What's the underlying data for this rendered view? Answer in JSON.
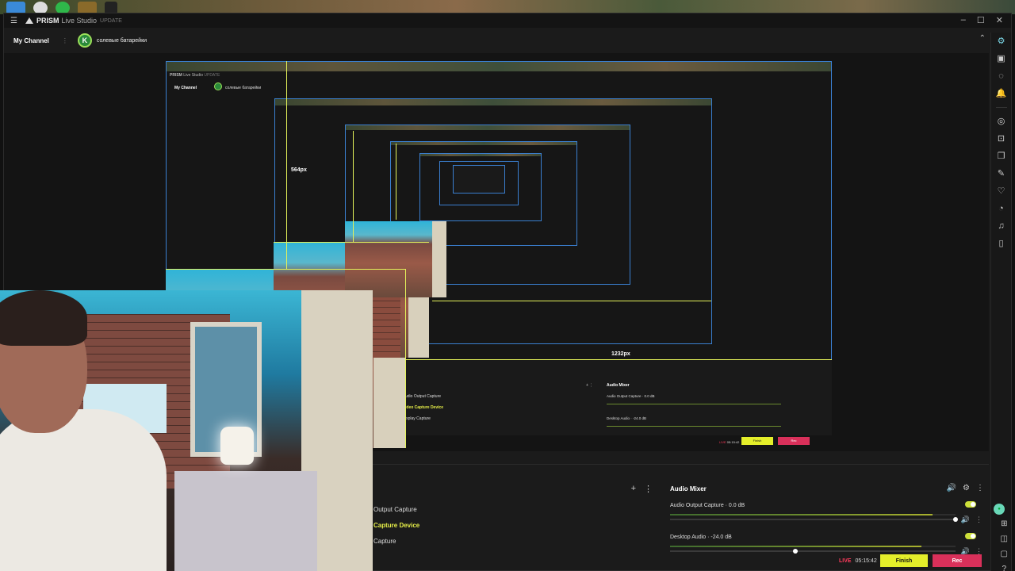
{
  "titlebar": {
    "app_name": "PRISM",
    "app_sub": "Live Studio",
    "update_label": "UPDATE"
  },
  "channelbar": {
    "my_channel": "My Channel",
    "channel_name": "солевые батарейки",
    "avatar_letter": "K"
  },
  "preview": {
    "nested_px_label_1": "564px",
    "nested_px_label_2": "1232px",
    "nested_frame_1": {
      "app_name": "PRISM",
      "app_sub": "Live Studio",
      "update_label": "UPDATE",
      "my_channel": "My Channel",
      "channel_name": "солевые батарейки",
      "mixer_title": "Audio Mixer",
      "channels": [
        "Audio Output Capture · 0.0 dB",
        "Desktop Audio · -24.0 dB"
      ],
      "sources": [
        "udio Output Capture",
        "ideo Capture Device",
        "isplay Capture"
      ],
      "live": "LIVE",
      "time": "05:15:42",
      "finish": "Finish",
      "rec": "Rec"
    }
  },
  "sources": {
    "items": [
      {
        "label": "Output Capture",
        "active": false
      },
      {
        "label": "Capture Device",
        "active": true
      },
      {
        "label": "Capture",
        "active": false
      }
    ]
  },
  "mixer": {
    "title": "Audio Mixer",
    "channels": [
      {
        "label": "Audio Output Capture · 0.0 dB",
        "level": 0.92,
        "volume": 1.0
      },
      {
        "label": "Desktop Audio · -24.0 dB",
        "level": 0.88,
        "volume": 0.44
      }
    ]
  },
  "status": {
    "live": "LIVE",
    "time": "05:15:42",
    "finish": "Finish",
    "rec": "Rec"
  },
  "colors": {
    "accent_yellow": "#e4ee2a",
    "rec_red": "#d9305a",
    "guide": "#e4f25a",
    "frame_blue": "#3a7fd0"
  },
  "sidebar_icons": [
    "settings-gear-icon",
    "scene-icon",
    "chat-icon",
    "notification-icon",
    "camera-icon",
    "capture-icon",
    "layers-icon",
    "effects-icon",
    "heart-icon",
    "sticker-icon",
    "music-icon",
    "widget-icon"
  ]
}
